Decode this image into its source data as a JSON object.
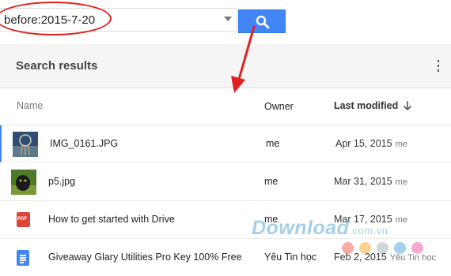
{
  "search": {
    "query": "before:2015-7-20"
  },
  "panel": {
    "title": "Search results"
  },
  "columns": {
    "name": "Name",
    "owner": "Owner",
    "modified": "Last modified"
  },
  "rows": [
    {
      "name": "IMG_0161.JPG",
      "owner": "me",
      "date": "Apr 15, 2015",
      "by": "me",
      "icon": "image-thumbnail"
    },
    {
      "name": "p5.jpg",
      "owner": "me",
      "date": "Mar 31, 2015",
      "by": "me",
      "icon": "image-thumbnail"
    },
    {
      "name": "How to get started with Drive",
      "owner": "me",
      "date": "Mar 17, 2015",
      "by": "me",
      "icon": "pdf-icon"
    },
    {
      "name": "Giveaway Glary Utilities Pro Key 100% Free",
      "owner": "Yêu Tin học",
      "date": "Feb 2, 2015",
      "by": "Yêu Tin học",
      "icon": "doc-icon"
    }
  ],
  "pdf_label": "PDF",
  "watermark": {
    "text": "Download",
    "suffix": ".com.vn"
  },
  "colors": {
    "accent": "#4285f4",
    "annotation": "#e02020",
    "pdf": "#db4437"
  }
}
